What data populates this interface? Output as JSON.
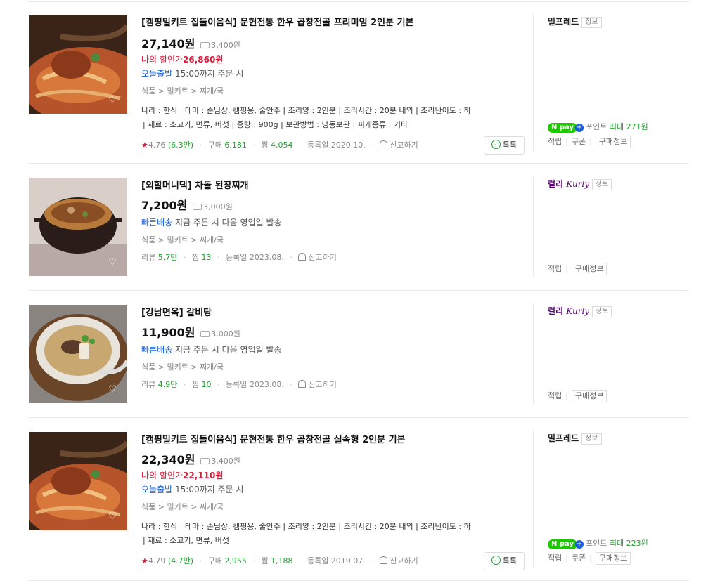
{
  "items": [
    {
      "title": "[캠핑밀키트 집들이음식] 문현전통 한우 곱창전골 프리미엄 2인분 기본",
      "price": "27,140원",
      "shipping": "3,400원",
      "discount_label": "나의 할인가",
      "discount_price": "26,860원",
      "delivery_hl": "오늘출발",
      "delivery_text": "15:00까지 주문 시",
      "category": "식품 > 밀키트 > 찌개/국",
      "specs_line1": "나라 : 한식 | 테마 : 손님상, 캠핑용, 술안주 | 조리양 : 2인분 | 조리시간 : 20분 내외 | 조리난이도 : 하",
      "specs_line2": "| 재료 : 소고기, 면류, 버섯 | 중량 : 900g | 보관방법 : 냉동보관 | 찌개종류 : 기타",
      "rating": "4.76",
      "review_count": "(6.3만)",
      "purchase_label": "구매",
      "purchase_count": "6,181",
      "zzim_label": "찜",
      "zzim_count": "4,054",
      "reg_date": "등록일 2020.10.",
      "report": "신고하기",
      "talk": "톡톡",
      "mall": "밀프레드",
      "mall_info": "정보",
      "npay_label": "포인트",
      "npay_value": "최대 271원",
      "links": [
        "적립",
        "쿠폰",
        "구매정보"
      ]
    },
    {
      "title": "[외할머니댁] 차돌 된장찌개",
      "price": "7,200원",
      "shipping": "3,000원",
      "delivery_hl": "빠른배송",
      "delivery_text": "지금 주문 시 다음 영업일 발송",
      "category": "식품 > 밀키트 > 찌개/국",
      "review_label": "리뷰",
      "review_count": "5.7만",
      "zzim_label": "찜",
      "zzim_count": "13",
      "reg_date": "등록일 2023.08.",
      "report": "신고하기",
      "mall_a": "컬리",
      "mall_b": "Kurly",
      "mall_info": "정보",
      "links": [
        "적립",
        "구매정보"
      ]
    },
    {
      "title": "[강남면옥] 갈비탕",
      "price": "11,900원",
      "shipping": "3,000원",
      "delivery_hl": "빠른배송",
      "delivery_text": "지금 주문 시 다음 영업일 발송",
      "category": "식품 > 밀키트 > 찌개/국",
      "review_label": "리뷰",
      "review_count": "4.9만",
      "zzim_label": "찜",
      "zzim_count": "10",
      "reg_date": "등록일 2023.08.",
      "report": "신고하기",
      "mall_a": "컬리",
      "mall_b": "Kurly",
      "mall_info": "정보",
      "links": [
        "적립",
        "구매정보"
      ]
    },
    {
      "title": "[캠핑밀키트 집들이음식] 문현전통 한우 곱창전골 실속형 2인분 기본",
      "price": "22,340원",
      "shipping": "3,400원",
      "discount_label": "나의 할인가",
      "discount_price": "22,110원",
      "delivery_hl": "오늘출발",
      "delivery_text": "15:00까지 주문 시",
      "category": "식품 > 밀키트 > 찌개/국",
      "specs_line1": "나라 : 한식 | 테마 : 손님상, 캠핑용, 술안주 | 조리양 : 2인분 | 조리시간 : 20분 내외 | 조리난이도 : 하",
      "specs_line2": "| 재료 : 소고기, 면류, 버섯",
      "rating": "4.79",
      "review_count": "(4.7만)",
      "purchase_label": "구매",
      "purchase_count": "2,955",
      "zzim_label": "찜",
      "zzim_count": "1,188",
      "reg_date": "등록일 2019.07.",
      "report": "신고하기",
      "talk": "톡톡",
      "mall": "밀프레드",
      "mall_info": "정보",
      "npay_label": "포인트",
      "npay_value": "최대 223원",
      "links": [
        "적립",
        "쿠폰",
        "구매정보"
      ]
    }
  ]
}
